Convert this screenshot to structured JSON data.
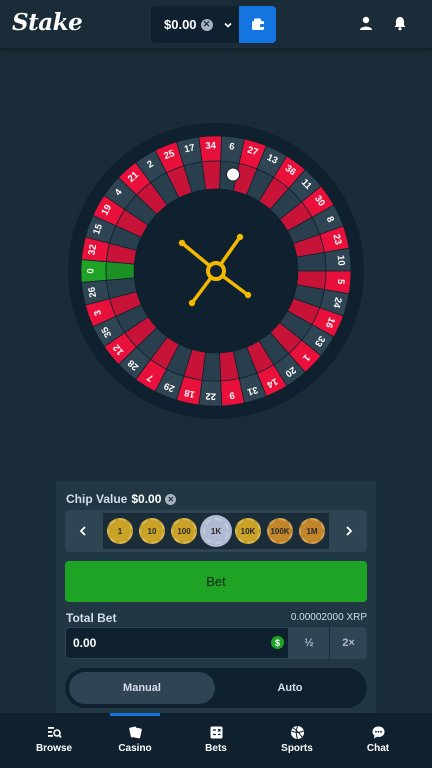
{
  "header": {
    "logo": "Stake",
    "balance": "$0.00",
    "currency_icon": "xrp-coin-icon"
  },
  "wheel": {
    "numbers": [
      "0",
      "32",
      "15",
      "19",
      "4",
      "21",
      "2",
      "25",
      "17",
      "34",
      "6",
      "27",
      "13",
      "36",
      "11",
      "30",
      "8",
      "23",
      "10",
      "5",
      "24",
      "16",
      "33",
      "1",
      "20",
      "14",
      "31",
      "9",
      "22",
      "18",
      "29",
      "7",
      "28",
      "12",
      "35",
      "3",
      "26"
    ],
    "colors": {
      "red": "#e9113c",
      "dark": "#2f4553",
      "green": "#1fa324",
      "outer": "#0f212e",
      "inner": "#0f212e",
      "rotor": "#f5b800"
    }
  },
  "controls": {
    "chip_label": "Chip Value",
    "chip_value": "$0.00",
    "chips": [
      "1",
      "10",
      "100",
      "1K",
      "10K",
      "100K",
      "1M"
    ],
    "selected_chip": "1K",
    "bet_label": "Bet",
    "total_bet_label": "Total Bet",
    "total_bet_value": "0.00002000 XRP",
    "amount": "0.00",
    "half_label": "½",
    "double_label": "2×",
    "modes": [
      "Manual",
      "Auto"
    ],
    "active_mode": "Manual"
  },
  "bottom_nav": {
    "items": [
      {
        "label": "Browse",
        "icon": "browse-icon"
      },
      {
        "label": "Casino",
        "icon": "casino-icon"
      },
      {
        "label": "Bets",
        "icon": "bets-icon"
      },
      {
        "label": "Sports",
        "icon": "sports-icon"
      },
      {
        "label": "Chat",
        "icon": "chat-icon"
      }
    ],
    "active": "Casino"
  }
}
